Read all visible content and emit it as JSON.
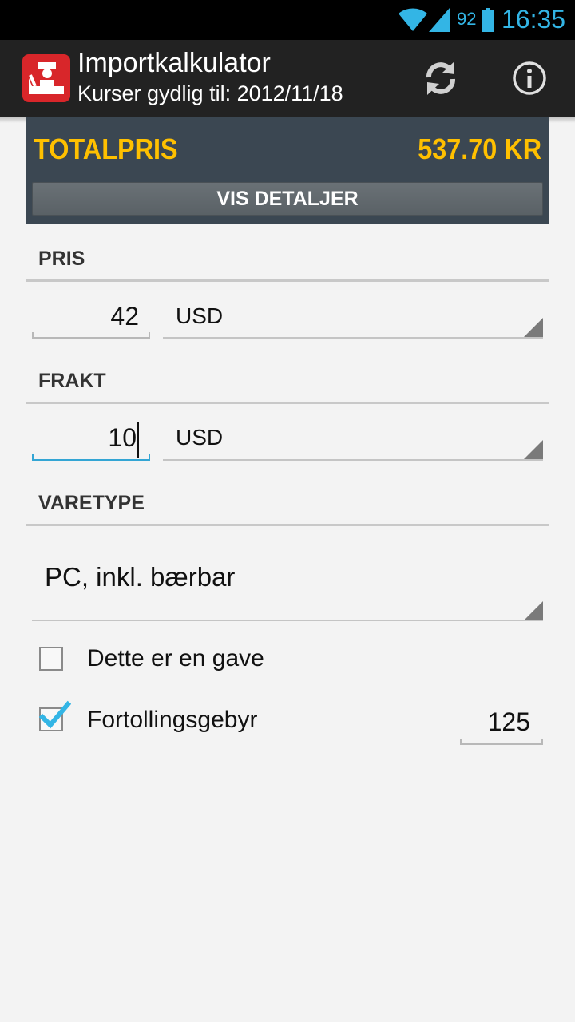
{
  "status_bar": {
    "battery_percent": "92",
    "time": "16:35",
    "icons": [
      "wifi-icon",
      "signal-icon",
      "battery-icon"
    ]
  },
  "action_bar": {
    "title": "Importkalkulator",
    "subtitle": "Kurser gydlig til: 2012/11/18",
    "icons": [
      "app-logo-icon",
      "refresh-icon",
      "info-icon"
    ]
  },
  "total": {
    "label": "TOTALPRIS",
    "value": "537.70 KR",
    "details_button": "VIS DETALJER"
  },
  "price": {
    "header": "PRIS",
    "amount": "42",
    "currency": "USD"
  },
  "shipping": {
    "header": "FRAKT",
    "amount": "10",
    "currency": "USD"
  },
  "item_type": {
    "header": "VARETYPE",
    "selected": "PC, inkl. bærbar"
  },
  "options": {
    "gift_label": "Dette er en gave",
    "gift_checked": false,
    "customs_fee_label": "Fortollingsgebyr",
    "customs_fee_checked": true,
    "customs_fee_value": "125"
  },
  "colors": {
    "accent": "#33b5e5",
    "total_text": "#ffc000",
    "total_panel": "#3b4752",
    "app_icon": "#d8262a",
    "action_bar": "#222222"
  }
}
